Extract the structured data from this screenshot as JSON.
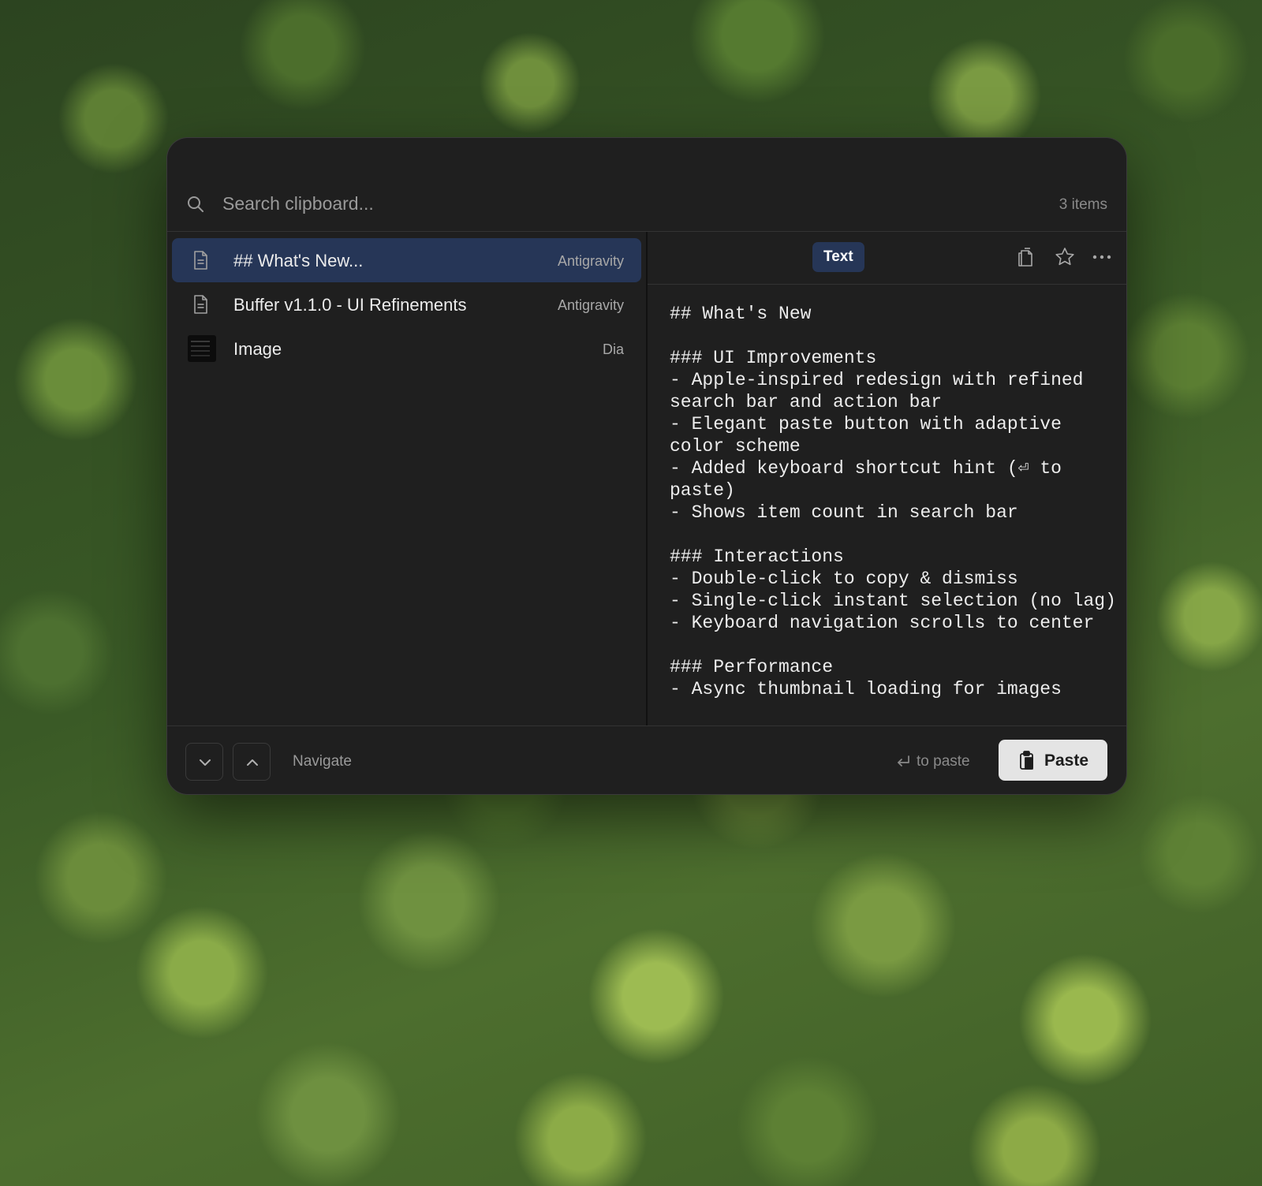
{
  "search": {
    "placeholder": "Search clipboard...",
    "count": "3 items"
  },
  "list": {
    "items": [
      {
        "title": "## What's New...",
        "source": "Antigravity",
        "kind": "text",
        "icon": "document-icon",
        "selected": true
      },
      {
        "title": "Buffer v1.1.0 - UI Refinements",
        "source": "Antigravity",
        "kind": "text",
        "icon": "document-icon",
        "selected": false
      },
      {
        "title": "Image",
        "source": "Dia",
        "kind": "image",
        "icon": "image-thumbnail",
        "selected": false
      }
    ]
  },
  "preview": {
    "type_label": "Text",
    "actions": [
      "copy-icon",
      "star-icon",
      "more-icon"
    ],
    "content": "## What's New\n\n### UI Improvements\n- Apple-inspired redesign with refined search bar and action bar\n- Elegant paste button with adaptive color scheme\n- Added keyboard shortcut hint (⏎ to paste)\n- Shows item count in search bar\n\n### Interactions\n- Double-click to copy & dismiss\n- Single-click instant selection (no lag)\n- Keyboard navigation scrolls to center\n\n### Performance\n- Async thumbnail loading for images"
  },
  "footer": {
    "navigate_label": "Navigate",
    "paste_hint": "to paste",
    "paste_label": "Paste"
  },
  "colors": {
    "window_bg": "#1f1f1f",
    "selection": "#263657",
    "paste_button": "#e4e4e4"
  }
}
